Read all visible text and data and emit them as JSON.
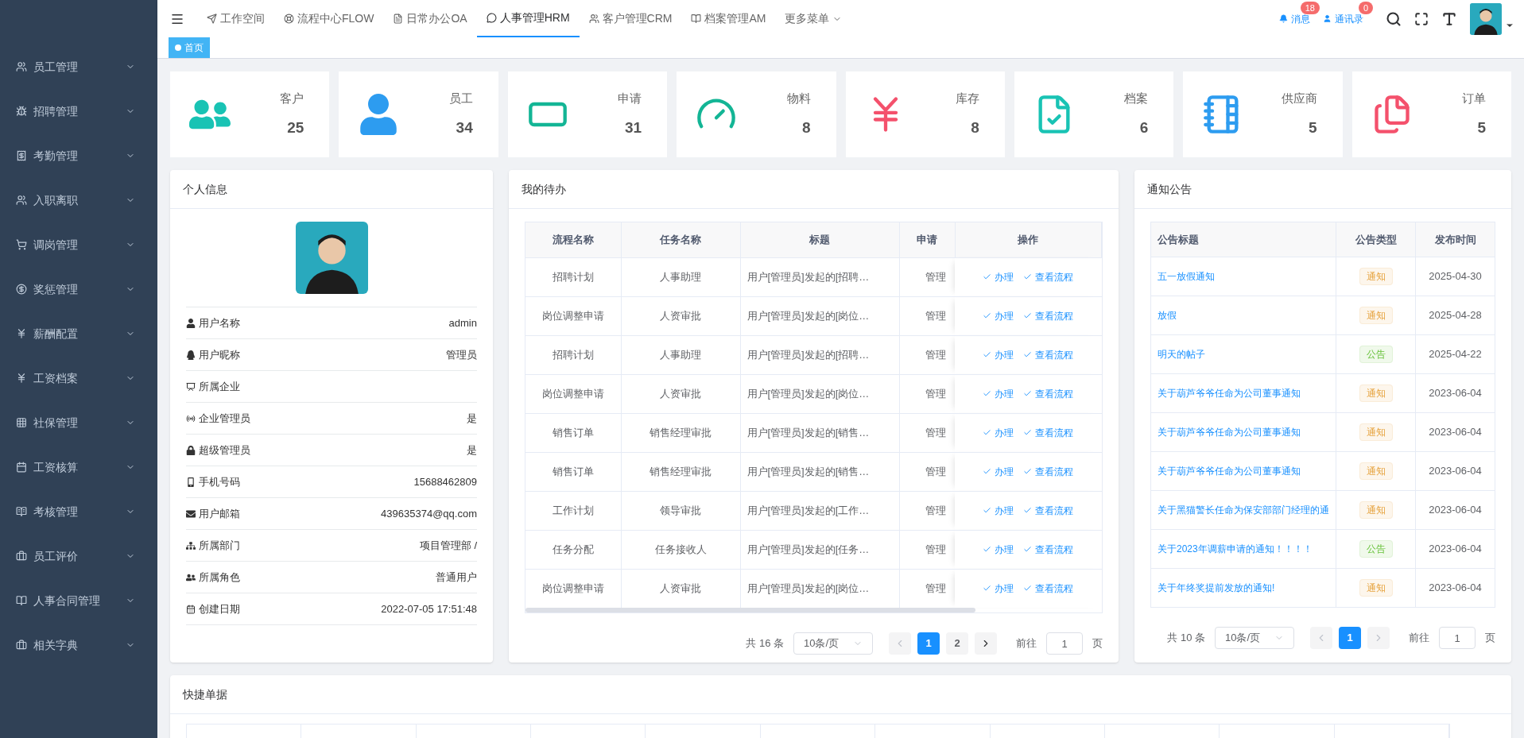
{
  "sidebar": {
    "items": [
      {
        "label": "员工管理"
      },
      {
        "label": "招聘管理"
      },
      {
        "label": "考勤管理"
      },
      {
        "label": "入职离职"
      },
      {
        "label": "调岗管理"
      },
      {
        "label": "奖惩管理"
      },
      {
        "label": "薪酬配置"
      },
      {
        "label": "工资档案"
      },
      {
        "label": "社保管理"
      },
      {
        "label": "工资核算"
      },
      {
        "label": "考核管理"
      },
      {
        "label": "员工评价"
      },
      {
        "label": "人事合同管理"
      },
      {
        "label": "相关字典"
      }
    ]
  },
  "topnav": {
    "tabs": [
      {
        "label": "工作空间",
        "selected": false
      },
      {
        "label": "流程中心FLOW",
        "selected": false
      },
      {
        "label": "日常办公OA",
        "selected": false
      },
      {
        "label": "人事管理HRM",
        "selected": true
      },
      {
        "label": "客户管理CRM",
        "selected": false
      },
      {
        "label": "档案管理AM",
        "selected": false
      }
    ],
    "more": "更多菜单",
    "messages": {
      "label": "消息",
      "count": "18"
    },
    "contacts": {
      "label": "通讯录",
      "count": "0"
    }
  },
  "tagbar": {
    "tags": [
      {
        "label": "首页",
        "selected": true
      }
    ]
  },
  "stats": [
    {
      "label": "客户",
      "value": "25"
    },
    {
      "label": "员工",
      "value": "34"
    },
    {
      "label": "申请",
      "value": "31"
    },
    {
      "label": "物料",
      "value": "8"
    },
    {
      "label": "库存",
      "value": "8"
    },
    {
      "label": "档案",
      "value": "6"
    },
    {
      "label": "供应商",
      "value": "5"
    },
    {
      "label": "订单",
      "value": "5"
    }
  ],
  "profile": {
    "title": "个人信息",
    "fields": [
      {
        "label": "用户名称",
        "value": "admin"
      },
      {
        "label": "用户昵称",
        "value": "管理员"
      },
      {
        "label": "所属企业"
      },
      {
        "label": "企业管理员",
        "value": "是"
      },
      {
        "label": "超级管理员",
        "value": "是"
      },
      {
        "label": "手机号码",
        "value": "15688462809"
      },
      {
        "label": "用户邮箱",
        "value": "439635374@qq.com"
      },
      {
        "label": "所属部门",
        "value": "项目管理部 /"
      },
      {
        "label": "所属角色",
        "value": "普通用户"
      },
      {
        "label": "创建日期",
        "value": "2022-07-05 17:51:48"
      }
    ]
  },
  "todo": {
    "title": "我的待办",
    "columns": [
      "流程名称",
      "任务名称",
      "标题",
      "申请",
      "操作"
    ],
    "rows": [
      {
        "process": "招聘计划",
        "task": "人事助理",
        "title": "用户[管理员]发起的[招聘…",
        "applicant": "管理",
        "actions": [
          "办理",
          "查看流程"
        ]
      },
      {
        "process": "岗位调整申请",
        "task": "人资审批",
        "title": "用户[管理员]发起的[岗位…",
        "applicant": "管理",
        "actions": [
          "办理",
          "查看流程"
        ]
      },
      {
        "process": "招聘计划",
        "task": "人事助理",
        "title": "用户[管理员]发起的[招聘…",
        "applicant": "管理",
        "actions": [
          "办理",
          "查看流程"
        ]
      },
      {
        "process": "岗位调整申请",
        "task": "人资审批",
        "title": "用户[管理员]发起的[岗位…",
        "applicant": "管理",
        "actions": [
          "办理",
          "查看流程"
        ]
      },
      {
        "process": "销售订单",
        "task": "销售经理审批",
        "title": "用户[管理员]发起的[销售…",
        "applicant": "管理",
        "actions": [
          "办理",
          "查看流程"
        ]
      },
      {
        "process": "销售订单",
        "task": "销售经理审批",
        "title": "用户[管理员]发起的[销售…",
        "applicant": "管理",
        "actions": [
          "办理",
          "查看流程"
        ]
      },
      {
        "process": "工作计划",
        "task": "领导审批",
        "title": "用户[管理员]发起的[工作…",
        "applicant": "管理",
        "actions": [
          "办理",
          "查看流程"
        ]
      },
      {
        "process": "任务分配",
        "task": "任务接收人",
        "title": "用户[管理员]发起的[任务…",
        "applicant": "管理",
        "actions": [
          "办理",
          "查看流程"
        ]
      },
      {
        "process": "岗位调整申请",
        "task": "人资审批",
        "title": "用户[管理员]发起的[岗位…",
        "applicant": "管理",
        "actions": [
          "办理",
          "查看流程"
        ]
      }
    ],
    "pagination": {
      "total": "共 16 条",
      "page_size": "10条/页",
      "prev_disabled": true,
      "next_disabled": false,
      "pages": [
        {
          "label": "1",
          "selected": true
        },
        {
          "label": "2",
          "selected": false
        }
      ],
      "goto_label": "前往",
      "goto_value": "1",
      "page_suffix": "页"
    }
  },
  "notices": {
    "title": "通知公告",
    "columns": [
      "公告标题",
      "公告类型",
      "发布时间"
    ],
    "rows": [
      {
        "title": "五一放假通知",
        "type": "通知",
        "kind": "notice",
        "date": "2025-04-30"
      },
      {
        "title": "放假",
        "type": "通知",
        "kind": "notice",
        "date": "2025-04-28"
      },
      {
        "title": "明天的帖子",
        "type": "公告",
        "kind": "announcement",
        "date": "2025-04-22"
      },
      {
        "title": "关于葫芦爷爷任命为公司董事通知",
        "type": "通知",
        "kind": "notice",
        "date": "2023-06-04"
      },
      {
        "title": "关于葫芦爷爷任命为公司董事通知",
        "type": "通知",
        "kind": "notice",
        "date": "2023-06-04"
      },
      {
        "title": "关于葫芦爷爷任命为公司董事通知",
        "type": "通知",
        "kind": "notice",
        "date": "2023-06-04"
      },
      {
        "title": "关于黑猫警长任命为保安部部门经理的通",
        "type": "通知",
        "kind": "notice",
        "date": "2023-06-04"
      },
      {
        "title": "关于2023年调薪申请的通知！！！！",
        "type": "公告",
        "kind": "announcement",
        "date": "2023-06-04"
      },
      {
        "title": "关于年终奖提前发放的通知!",
        "type": "通知",
        "kind": "notice",
        "date": "2023-06-04"
      }
    ],
    "pagination": {
      "total": "共 10 条",
      "page_size": "10条/页",
      "prev_disabled": true,
      "next_disabled": true,
      "pages": [
        {
          "label": "1",
          "selected": true
        }
      ],
      "goto_label": "前往",
      "goto_value": "1",
      "page_suffix": "页"
    }
  },
  "quick": {
    "title": "快捷单据"
  }
}
